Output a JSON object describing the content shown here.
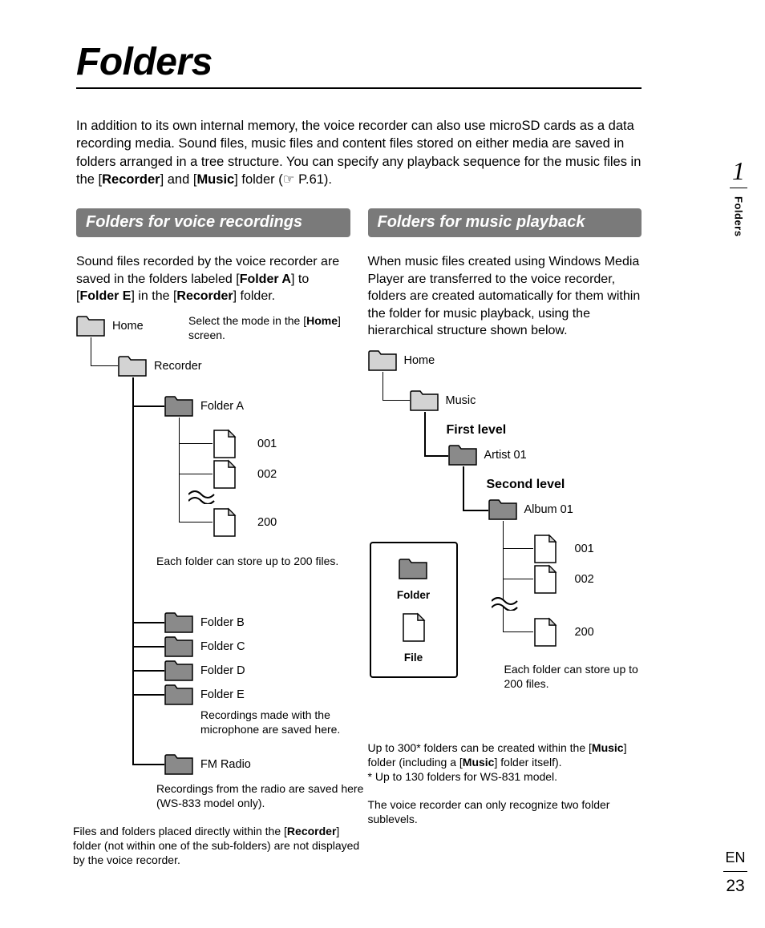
{
  "title": "Folders",
  "intro_parts": {
    "p1": "In addition to its own internal memory, the voice recorder can also use microSD cards as a data recording media. Sound files, music files and content files stored on either media are saved in folders arranged in a tree structure. You can specify any playback sequence for the music files in the [",
    "b1": "Recorder",
    "p2": "] and [",
    "b2": "Music",
    "p3": "] folder (☞ P.61)."
  },
  "left": {
    "heading": "Folders for voice recordings",
    "para_parts": {
      "p1": "Sound files recorded by the voice recorder are saved in the folders labeled [",
      "b1": "Folder A",
      "p2": "] to [",
      "b2": "Folder E",
      "p3": "] in the [",
      "b3": "Recorder",
      "p4": "] folder."
    },
    "home": "Home",
    "home_note_parts": {
      "p1": "Select the mode in the [",
      "b1": "Home",
      "p2": "] screen."
    },
    "recorder": "Recorder",
    "folder_a": "Folder A",
    "f001": "001",
    "f002": "002",
    "f200": "200",
    "each": "Each folder can store up to 200 files.",
    "folder_b": "Folder B",
    "folder_c": "Folder C",
    "folder_d": "Folder D",
    "folder_e": "Folder E",
    "mic_note": "Recordings made with the microphone are saved here.",
    "fm": "FM Radio",
    "radio_note": "Recordings from the radio are saved here (WS-833 model only).",
    "foot_parts": {
      "p1": "Files and folders placed directly within the [",
      "b1": "Recorder",
      "p2": "] folder (not within one of the sub-folders) are not displayed by the voice recorder."
    }
  },
  "right": {
    "heading": "Folders for music playback",
    "para": "When music files created using Windows Media Player are transferred to the voice recorder, folders are created automatically for them within the folder for music playback, using the hierarchical structure shown below.",
    "home": "Home",
    "music": "Music",
    "first_level": "First level",
    "artist": "Artist 01",
    "second_level": "Second level",
    "album": "Album 01",
    "f001": "001",
    "f002": "002",
    "f200": "200",
    "each": "Each folder can store up to 200 files.",
    "legend_folder": "Folder",
    "legend_file": "File",
    "foot1_parts": {
      "p1": "Up to 300* folders can be created within the [",
      "b1": "Music",
      "p2": "] folder (including a [",
      "b2": "Music",
      "p3": "] folder itself)."
    },
    "foot1b": "* Up to 130 folders for WS-831 model.",
    "foot2": "The voice recorder can only recognize two folder sublevels."
  },
  "sidebar": {
    "index": "1",
    "tab": "Folders"
  },
  "footer": {
    "lang": "EN",
    "page": "23"
  }
}
